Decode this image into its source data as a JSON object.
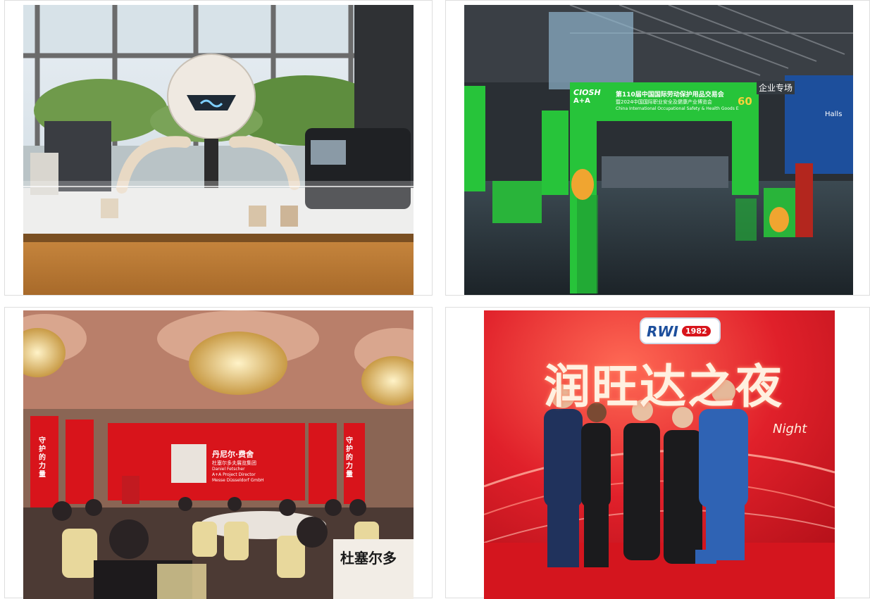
{
  "gallery": {
    "photos": [
      {
        "id": "robot-barista",
        "subject": "robot-arm-coffee-station"
      },
      {
        "id": "expo-entrance",
        "subject": "trade-fair-entrance-gate",
        "signage": {
          "gate_title_cn": "第110届中国国际劳动保护用品交易会",
          "gate_subtitle_cn": "暨2024中国国际职业安全及健康产业博览会",
          "gate_title_en": "China International Occupational Safety & Health Goods Expo",
          "gate_logo_text": "CIOSH",
          "anniversary": "60",
          "hall_sign": "企业专场",
          "hall_en": "Halls"
        }
      },
      {
        "id": "banquet-hall",
        "subject": "banquet-presentation",
        "signage": {
          "screen_name_cn": "丹尼尔·费舍",
          "screen_role_cn": "杜塞尔多夫展览集团",
          "screen_name_en": "Daniel Fetscher",
          "screen_role_en": "A+A Project Director",
          "screen_org_en": "Messe Düsseldorf GmbH",
          "banner_cn": "守护的力量",
          "table_card_cn": "杜塞尔多"
        }
      },
      {
        "id": "night-event",
        "subject": "group-photo-red-stage",
        "signage": {
          "logo_text": "RWI",
          "logo_year": "1982",
          "title_cn": "润旺达之夜",
          "title_en": "Night"
        }
      }
    ]
  },
  "colors": {
    "expo_green": "#27c43a",
    "banner_red": "#d8141b",
    "stage_red": "#e0202a",
    "logo_blue": "#1d4f9c"
  }
}
